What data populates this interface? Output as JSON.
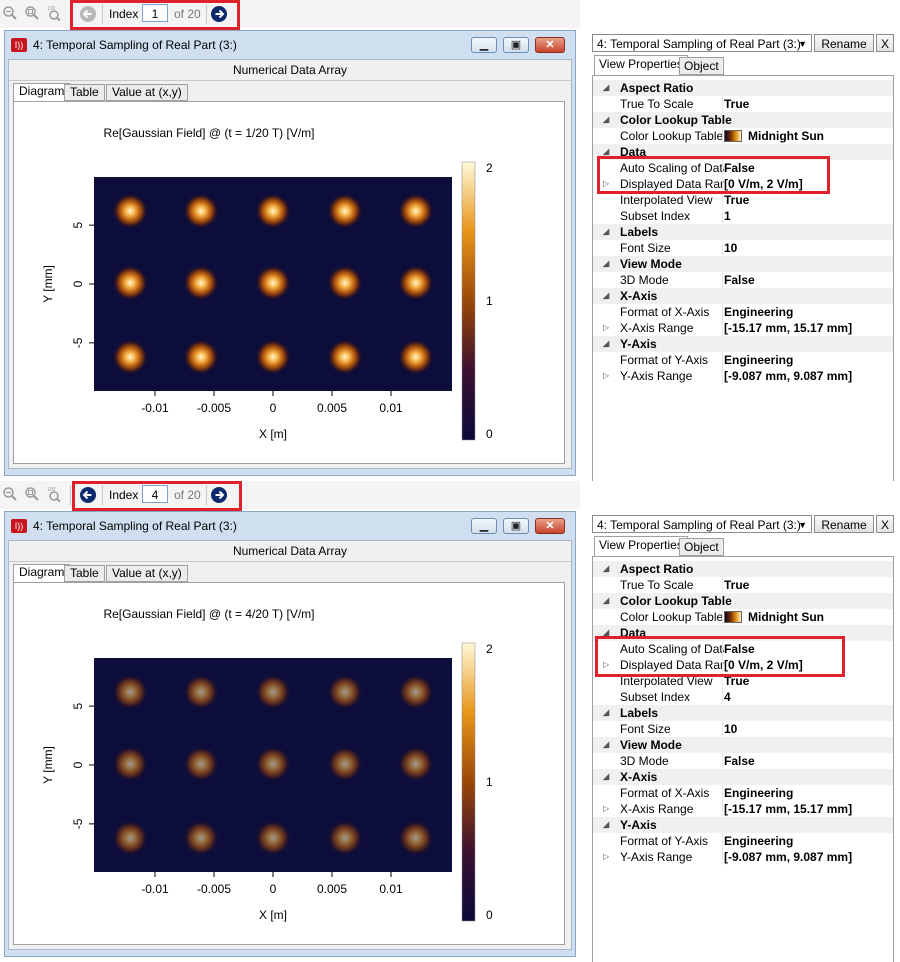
{
  "colors": {
    "accent_red": "#e0202a",
    "nav_blue": "#0b2a6e",
    "plot_bg": "#0c0d3a"
  },
  "panels": [
    {
      "index_label": "Index",
      "index_value": "1",
      "index_of": "of 20",
      "window_title": "4: Temporal Sampling of Real Part (3:)",
      "subtitle": "Numerical Data Array",
      "tabs": [
        "Diagram",
        "Table",
        "Value at (x,y)"
      ],
      "plot": {
        "title": "Re[Gaussian Field] @ (t = 1/20 T)  [V/m]",
        "xlabel": "X [m]",
        "ylabel": "Y [mm]",
        "xticks": [
          "-0.01",
          "-0.005",
          "0",
          "0.005",
          "0.01"
        ],
        "yticks": [
          "5",
          "0",
          "-5"
        ],
        "cticks": [
          "2",
          "1",
          "0"
        ],
        "spot_level": 1.0
      },
      "combo": "4: Temporal Sampling of Real Part (3:)",
      "rename": "Rename",
      "close": "X",
      "prop_tabs": [
        "View Properties",
        "Object"
      ],
      "props": [
        {
          "cat": "Aspect Ratio"
        },
        {
          "name": "True To Scale",
          "value": "True"
        },
        {
          "cat": "Color Lookup Table"
        },
        {
          "name": "Color Lookup Table",
          "value": "Midnight Sun",
          "swatch": true
        },
        {
          "cat": "Data"
        },
        {
          "name": "Auto Scaling of Data",
          "value": "False"
        },
        {
          "name": "Displayed Data Ran",
          "value": "[0 V/m, 2 V/m]",
          "expand": true
        },
        {
          "name": "Interpolated View",
          "value": "True"
        },
        {
          "name": "Subset Index",
          "value": "1"
        },
        {
          "cat": "Labels"
        },
        {
          "name": "Font Size",
          "value": "10"
        },
        {
          "cat": "View Mode"
        },
        {
          "name": "3D Mode",
          "value": "False"
        },
        {
          "cat": "X-Axis"
        },
        {
          "name": "Format of X-Axis",
          "value": "Engineering"
        },
        {
          "name": "X-Axis Range",
          "value": "[-15.17 mm, 15.17 mm]",
          "expand": true
        },
        {
          "cat": "Y-Axis"
        },
        {
          "name": "Format of Y-Axis",
          "value": "Engineering"
        },
        {
          "name": "Y-Axis Range",
          "value": "[-9.087 mm, 9.087 mm]",
          "expand": true
        }
      ]
    },
    {
      "index_label": "Index",
      "index_value": "4",
      "index_of": "of 20",
      "window_title": "4: Temporal Sampling of Real Part (3:)",
      "subtitle": "Numerical Data Array",
      "tabs": [
        "Diagram",
        "Table",
        "Value at (x,y)"
      ],
      "plot": {
        "title": "Re[Gaussian Field] @ (t = 4/20 T)  [V/m]",
        "xlabel": "X [m]",
        "ylabel": "Y [mm]",
        "xticks": [
          "-0.01",
          "-0.005",
          "0",
          "0.005",
          "0.01"
        ],
        "yticks": [
          "5",
          "0",
          "-5"
        ],
        "cticks": [
          "2",
          "1",
          "0"
        ],
        "spot_level": 0.6
      },
      "combo": "4: Temporal Sampling of Real Part (3:)",
      "rename": "Rename",
      "close": "X",
      "prop_tabs": [
        "View Properties",
        "Object"
      ],
      "props": [
        {
          "cat": "Aspect Ratio"
        },
        {
          "name": "True To Scale",
          "value": "True"
        },
        {
          "cat": "Color Lookup Table"
        },
        {
          "name": "Color Lookup Table",
          "value": "Midnight Sun",
          "swatch": true
        },
        {
          "cat": "Data"
        },
        {
          "name": "Auto Scaling of Data",
          "value": "False"
        },
        {
          "name": "Displayed Data Ran",
          "value": "[0 V/m, 2 V/m]",
          "expand": true
        },
        {
          "name": "Interpolated View",
          "value": "True"
        },
        {
          "name": "Subset Index",
          "value": "4"
        },
        {
          "cat": "Labels"
        },
        {
          "name": "Font Size",
          "value": "10"
        },
        {
          "cat": "View Mode"
        },
        {
          "name": "3D Mode",
          "value": "False"
        },
        {
          "cat": "X-Axis"
        },
        {
          "name": "Format of X-Axis",
          "value": "Engineering"
        },
        {
          "name": "X-Axis Range",
          "value": "[-15.17 mm, 15.17 mm]",
          "expand": true
        },
        {
          "cat": "Y-Axis"
        },
        {
          "name": "Format of Y-Axis",
          "value": "Engineering"
        },
        {
          "name": "Y-Axis Range",
          "value": "[-9.087 mm, 9.087 mm]",
          "expand": true
        }
      ]
    }
  ]
}
